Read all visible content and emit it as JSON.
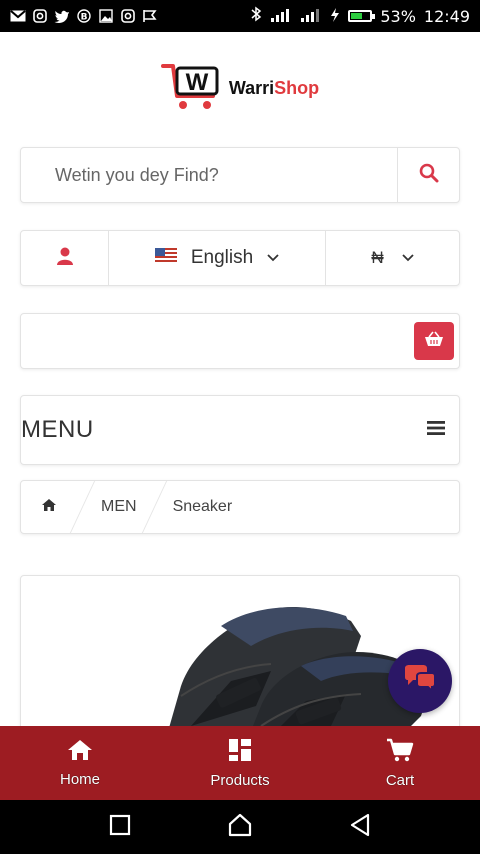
{
  "status_bar": {
    "battery": "53%",
    "time": "12:49",
    "notification_icons": [
      "gmail-icon",
      "instagram-icon",
      "twitter-icon",
      "b-icon",
      "gallery-icon",
      "instagram-icon",
      "flag-icon"
    ]
  },
  "brand": {
    "name_part1": "Warri",
    "name_part2": "Shop",
    "logo_letter": "W",
    "accent_color": "#e03a3e"
  },
  "search": {
    "placeholder": "Wetin you dey Find?"
  },
  "account_bar": {
    "language": "English",
    "currency": "₦"
  },
  "menu": {
    "label": "MENU"
  },
  "breadcrumb": {
    "items": [
      "MEN",
      "Sneaker"
    ]
  },
  "bottom_nav": {
    "items": [
      {
        "label": "Home",
        "icon": "home-icon"
      },
      {
        "label": "Products",
        "icon": "grid-icon"
      },
      {
        "label": "Cart",
        "icon": "cart-icon"
      }
    ],
    "background": "#9d1c22"
  },
  "colors": {
    "primary": "#9d1c22",
    "accent": "#d9384a",
    "chat": "#2b1766"
  }
}
